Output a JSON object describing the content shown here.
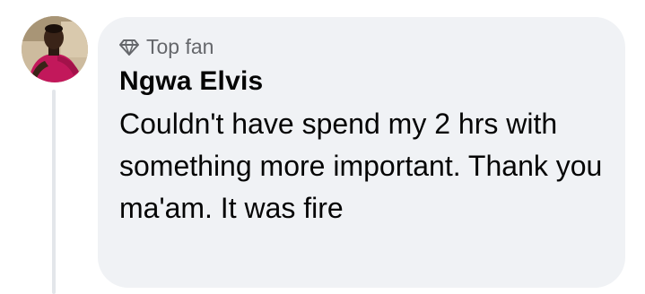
{
  "comment": {
    "badge": {
      "icon": "diamond-icon",
      "label": "Top fan"
    },
    "author": "Ngwa Elvis",
    "text": "Couldn't have spend my 2 hrs with something more important. Thank you ma'am. It was fire",
    "avatar_icon": "avatar-image"
  },
  "colors": {
    "bubble_bg": "#f0f2f5",
    "text_primary": "#050505",
    "text_secondary": "#65676b",
    "thread_line": "#e3e6ea"
  }
}
